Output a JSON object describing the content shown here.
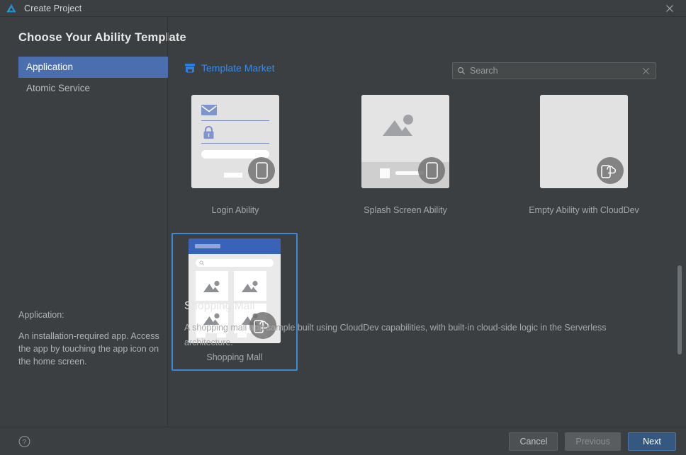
{
  "window": {
    "title": "Create Project",
    "app_icon": "deveco-logo-icon",
    "close_icon": "close-icon"
  },
  "page_title": "Choose Your Ability Template",
  "sidebar": {
    "items": [
      {
        "label": "Application",
        "selected": true
      },
      {
        "label": "Atomic Service",
        "selected": false
      }
    ],
    "description": {
      "heading": "Application:",
      "body": "An installation-required app. Access the app by touching the app icon on the home screen."
    }
  },
  "main": {
    "market_link": {
      "label": "Template Market",
      "icon": "storefront-icon"
    },
    "search": {
      "value": "Search",
      "placeholder": "Search",
      "search_icon": "search-icon",
      "clear_icon": "close-icon"
    },
    "templates": [
      {
        "label": "Login Ability",
        "selected": false,
        "badge": "phone-icon"
      },
      {
        "label": "Splash Screen Ability",
        "selected": false,
        "badge": "phone-icon"
      },
      {
        "label": "Empty Ability with CloudDev",
        "selected": false,
        "badge": "phone-cloud-icon"
      },
      {
        "label": "Shopping Mall",
        "selected": true,
        "badge": "phone-cloud-icon"
      }
    ],
    "detail": {
      "title": "Shopping Mall",
      "description": "A shopping mall app sample built using CloudDev capabilities, with built-in cloud-side logic in the Serverless architecture."
    },
    "scrollbar": {
      "name": "vertical-scrollbar"
    }
  },
  "footer": {
    "help_icon": "help-circle-icon",
    "buttons": [
      {
        "label": "Cancel",
        "style": "normal"
      },
      {
        "label": "Previous",
        "style": "disabled"
      },
      {
        "label": "Next",
        "style": "primary"
      }
    ]
  },
  "colors": {
    "background": "#3c3f41",
    "selection_blue": "#4b6eaf",
    "link_blue": "#3b8ae6",
    "primary_button": "#365880",
    "card_border_selected": "#3d8ad4",
    "thumb_gray": "#e2e2e2"
  }
}
